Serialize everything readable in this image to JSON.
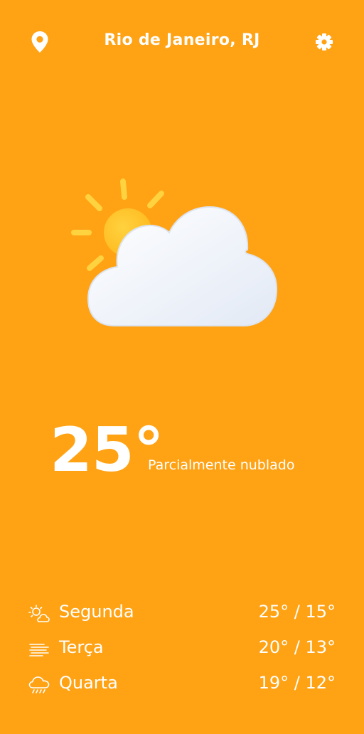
{
  "header": {
    "location_icon": "location-pin-icon",
    "city": "Rio de Janeiro, RJ",
    "settings_icon": "gear-icon"
  },
  "current": {
    "icon": "partly-cloudy-icon",
    "temperature": "25°",
    "condition": "Parcialmente nublado"
  },
  "forecast": [
    {
      "icon": "sun-cloud-icon",
      "day": "Segunda",
      "range": "25° / 15°"
    },
    {
      "icon": "fog-icon",
      "day": "Terça",
      "range": "20° / 13°"
    },
    {
      "icon": "rain-cloud-icon",
      "day": "Quarta",
      "range": "19° / 12°"
    }
  ],
  "colors": {
    "background": "#FFA214",
    "text": "#FFFFFF",
    "sun": "#FFC93A",
    "cloud": "#F4F7FC"
  }
}
